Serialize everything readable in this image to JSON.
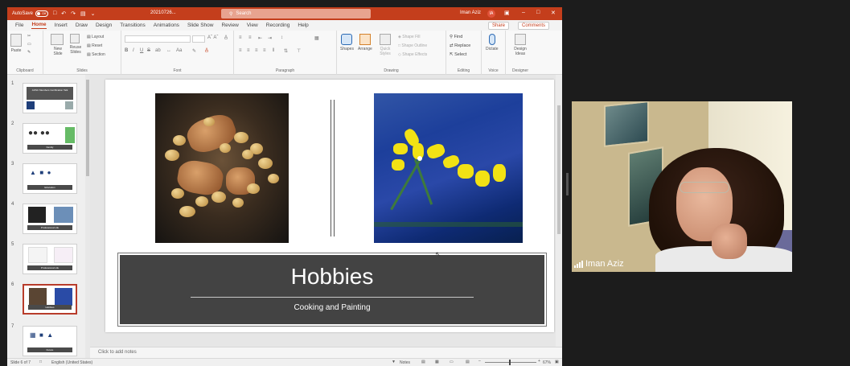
{
  "titlebar": {
    "autosave_label": "AutoSave",
    "autosave_state": "Off",
    "filename": "20210726...",
    "search_placeholder": "Search",
    "user_name": "Iman Aziz",
    "user_initials": "IA"
  },
  "menu": {
    "items": [
      "File",
      "Home",
      "Insert",
      "Draw",
      "Design",
      "Transitions",
      "Animations",
      "Slide Show",
      "Review",
      "View",
      "Recording",
      "Help"
    ],
    "active": "Home",
    "share_label": "Share",
    "comments_label": "Comments"
  },
  "ribbon": {
    "clipboard": {
      "paste": "Paste",
      "label": "Clipboard"
    },
    "slides": {
      "new_slide": "New Slide",
      "reuse": "Reuse Slides",
      "layout": "Layout",
      "reset": "Reset",
      "section": "Section",
      "label": "Slides"
    },
    "font": {
      "label": "Font",
      "bold": "B",
      "italic": "I",
      "underline": "U",
      "strike": "S",
      "shadow": "ab"
    },
    "paragraph": {
      "label": "Paragraph"
    },
    "drawing": {
      "shapes": "Shapes",
      "arrange": "Arrange",
      "quick_styles": "Quick Styles",
      "fill": "Shape Fill",
      "outline": "Shape Outline",
      "effects": "Shape Effects",
      "label": "Drawing"
    },
    "editing": {
      "find": "Find",
      "replace": "Replace",
      "select": "Select",
      "label": "Editing"
    },
    "voice": {
      "dictate": "Dictate",
      "label": "Voice"
    },
    "designer": {
      "ideas": "Design Ideas",
      "label": "Designer"
    }
  },
  "thumbnails": [
    {
      "num": "1",
      "caption": "AOSC Members Certification Talk"
    },
    {
      "num": "2",
      "caption": "Family"
    },
    {
      "num": "3",
      "caption": "Education"
    },
    {
      "num": "4",
      "caption": "Professional Life"
    },
    {
      "num": "5",
      "caption": "Professional Life"
    },
    {
      "num": "6",
      "caption": "Hobbies"
    },
    {
      "num": "7",
      "caption": "Future"
    }
  ],
  "slide": {
    "title": "Hobbies",
    "subtitle": "Cooking and Painting"
  },
  "notes_placeholder": "Click to add notes",
  "status": {
    "slide_count": "Slide 6 of 7",
    "language": "English (United States)",
    "notes": "Notes",
    "zoom": "67%"
  },
  "video": {
    "participant_name": "Iman Aziz"
  },
  "colors": {
    "accent": "#c43e1c",
    "title_box": "#434343"
  }
}
